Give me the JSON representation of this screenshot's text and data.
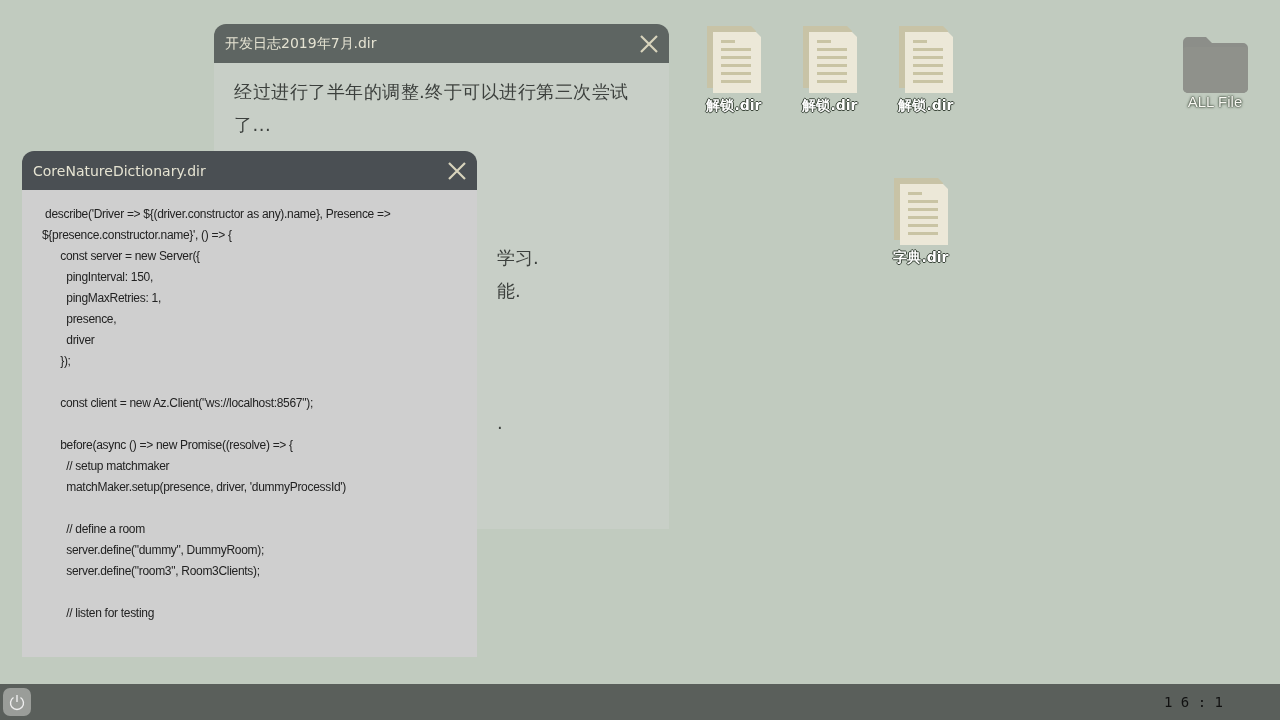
{
  "desktop_icons": [
    {
      "kind": "file",
      "label": "解锁.dir"
    },
    {
      "kind": "file",
      "label": "解锁.dir"
    },
    {
      "kind": "file",
      "label": "解锁.dir"
    },
    {
      "kind": "folder",
      "label": "ALL File"
    },
    {
      "kind": "file",
      "label": "字典.dir"
    }
  ],
  "windows": [
    {
      "title": "开发日志2019年7月.dir",
      "kind": "text",
      "lines": [
        "经过进行了半年的调整.终于可以进行第三次尝试了..."
      ],
      "fragments": [
        "学习.",
        "能.",
        "."
      ]
    },
    {
      "title": "CoreNatureDictionary.dir",
      "kind": "code",
      "blocks": [
        [
          " describe('Driver => ${(driver.constructor as any).name}, Presence =>",
          "${presence.constructor.name}', () => {",
          "      const server = new Server({",
          "        pingInterval: 150,",
          "        pingMaxRetries: 1,",
          "        presence,",
          "        driver",
          "      });"
        ],
        [
          "      const client = new Az.Client(\"ws://localhost:8567\");"
        ],
        [
          "      before(async () => new Promise((resolve) => {",
          "        // setup matchmaker",
          "        matchMaker.setup(presence, driver, 'dummyProcessId')"
        ],
        [
          "        // define a room",
          "        server.define(\"dummy\", DummyRoom);",
          "        server.define(\"room3\", Room3Clients);"
        ],
        [
          "        // listen for testing"
        ]
      ]
    }
  ],
  "taskbar": {
    "clock": "1 6 : 1"
  }
}
